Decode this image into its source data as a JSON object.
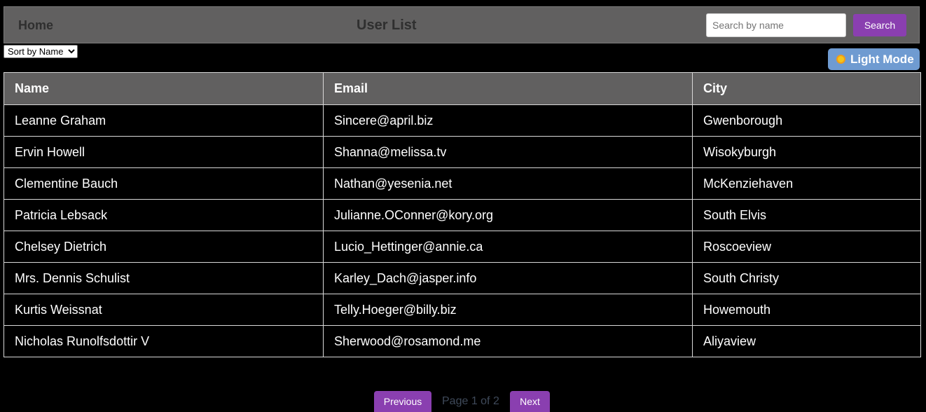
{
  "header": {
    "home_label": "Home",
    "title": "User List",
    "search_placeholder": "Search by name",
    "search_value": "",
    "search_button_label": "Search",
    "background_color": "#616060",
    "accent_color": "#8a3fb0"
  },
  "controls": {
    "sort_selected": "Sort by Name",
    "mode_toggle_label": "Light Mode",
    "mode_toggle_icon": "sun-icon",
    "mode_toggle_color": "#6f9bd1"
  },
  "table": {
    "columns": [
      "Name",
      "Email",
      "City"
    ],
    "rows": [
      [
        "Leanne Graham",
        "Sincere@april.biz",
        "Gwenborough"
      ],
      [
        "Ervin Howell",
        "Shanna@melissa.tv",
        "Wisokyburgh"
      ],
      [
        "Clementine Bauch",
        "Nathan@yesenia.net",
        "McKenziehaven"
      ],
      [
        "Patricia Lebsack",
        "Julianne.OConner@kory.org",
        "South Elvis"
      ],
      [
        "Chelsey Dietrich",
        "Lucio_Hettinger@annie.ca",
        "Roscoeview"
      ],
      [
        "Mrs. Dennis Schulist",
        "Karley_Dach@jasper.info",
        "South Christy"
      ],
      [
        "Kurtis Weissnat",
        "Telly.Hoeger@billy.biz",
        "Howemouth"
      ],
      [
        "Nicholas Runolfsdottir V",
        "Sherwood@rosamond.me",
        "Aliyaview"
      ]
    ]
  },
  "pagination": {
    "previous_label": "Previous",
    "page_info": "Page 1 of 2",
    "next_label": "Next"
  }
}
